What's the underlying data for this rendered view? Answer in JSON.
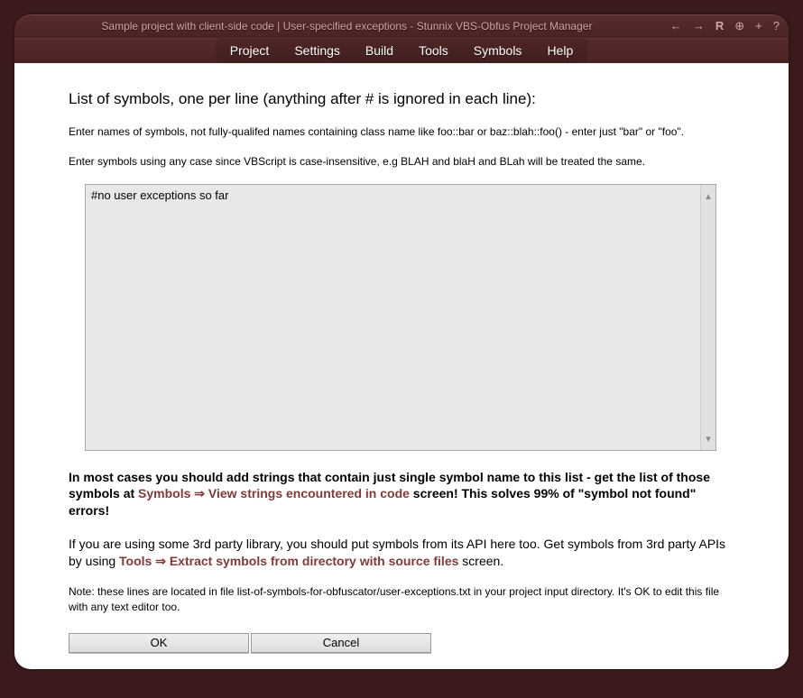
{
  "title": "Sample project with client-side code | User-specified exceptions - Stunnix VBS-Obfus Project Manager",
  "menu": [
    "Project",
    "Settings",
    "Build",
    "Tools",
    "Symbols",
    "Help"
  ],
  "heading": "List of symbols, one per line (anything after # is ignored in each line):",
  "para1": "Enter names of symbols, not fully-qualifed names containing class name like foo::bar or baz::blah::foo() - enter just \"bar\" or \"foo\".",
  "para2": "Enter symbols using any case since VBScript is case-insensitive, e.g BLAH and blaH and BLah will be treated the same.",
  "textarea_value": "#no user exceptions so far",
  "advice1_pre": "In most cases you should add strings that contain just single symbol name to this list - get the list of those symbols at ",
  "advice1_link": "Symbols ⇒ View strings encountered in code",
  "advice1_post": " screen! This solves 99% of \"symbol not found\" errors!",
  "advice2_pre": "If you are using some 3rd party library, you should put symbols from its API here too. Get symbols from 3rd party APIs by using ",
  "advice2_link": "Tools ⇒ Extract symbols from directory with source files",
  "advice2_post": " screen.",
  "note": "Note: these lines are located in file list-of-symbols-for-obfuscator/user-exceptions.txt in your project input directory. It's OK to edit this file with any text editor too.",
  "buttons": {
    "ok": "OK",
    "cancel": "Cancel"
  },
  "icons": {
    "back": "←",
    "fwd": "→",
    "reload": "R",
    "plus_circle": "⊕",
    "plus": "+",
    "help": "?"
  }
}
